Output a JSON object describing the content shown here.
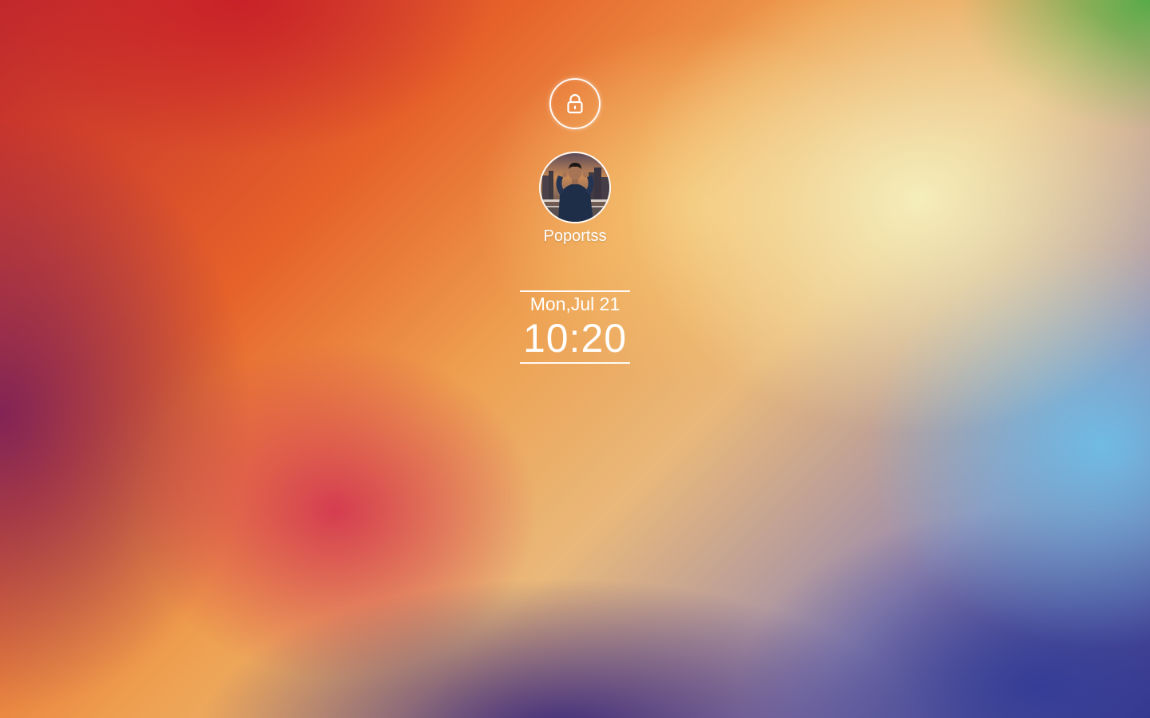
{
  "lock_screen": {
    "lock_icon": "lock-icon",
    "user": {
      "name": "Poportss",
      "avatar": "profile-photo"
    },
    "clock": {
      "date": "Mon,Jul 21",
      "time": "10:20"
    }
  },
  "colors": {
    "text": "#ffffff",
    "ring": "#ffffff"
  }
}
